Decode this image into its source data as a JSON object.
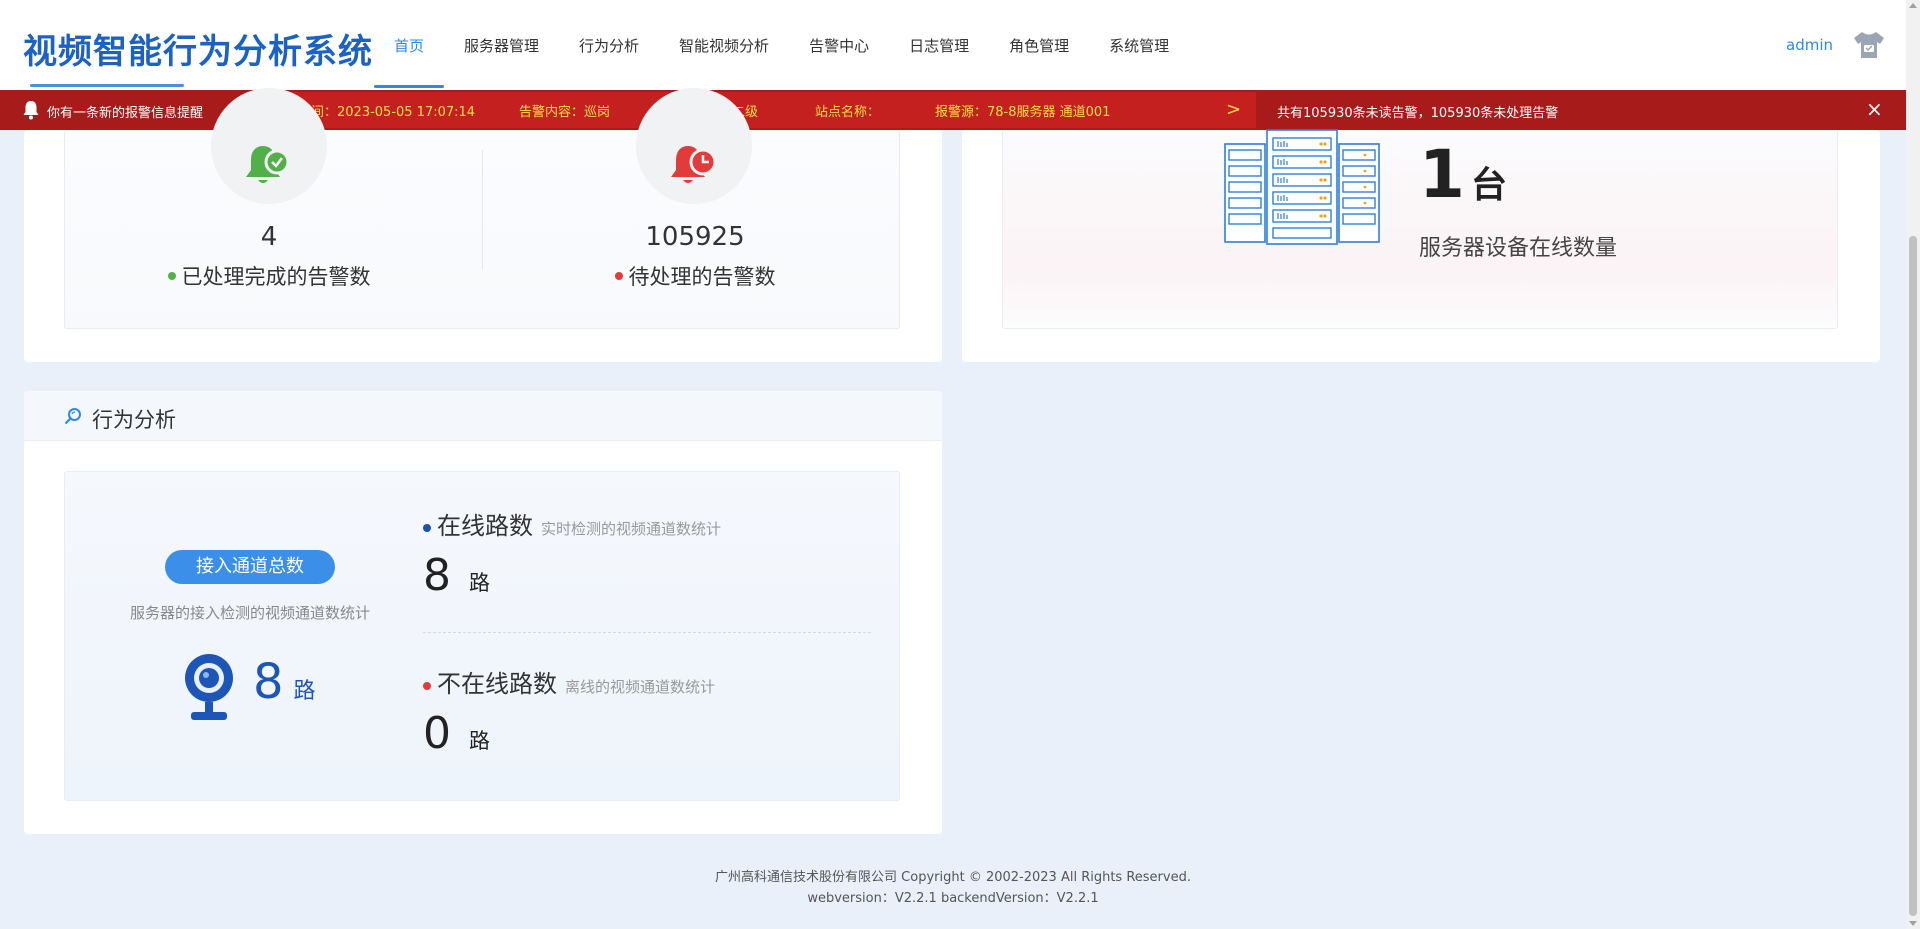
{
  "header": {
    "app_title": "视频智能行为分析系统",
    "nav": [
      {
        "label": "首页",
        "active": true
      },
      {
        "label": "服务器管理",
        "active": false
      },
      {
        "label": "行为分析",
        "active": false
      },
      {
        "label": "智能视频分析",
        "active": false
      },
      {
        "label": "告警中心",
        "active": false
      },
      {
        "label": "日志管理",
        "active": false
      },
      {
        "label": "角色管理",
        "active": false
      },
      {
        "label": "系统管理",
        "active": false
      }
    ],
    "user_name": "admin",
    "icons": {
      "skin": "shirt-icon"
    }
  },
  "alert_bar": {
    "message": "你有一条新的报警信息提醒",
    "alarm_time": "告警时间：2023-05-05 17:07:14",
    "alarm_content": "告警内容：巡岗",
    "alarm_level": "告警级别：二级",
    "site_name": "站点名称：",
    "alarm_source": "报警源：78-8服务器 通道001",
    "next_glyph": ">",
    "summary": "共有105930条未读告警，105930条未处理告警",
    "close_glyph": "×",
    "colors": {
      "bar": "#a81b1b",
      "ticker": "#c42020",
      "highlight": "#ffe046"
    }
  },
  "alarm_stats": {
    "processed": {
      "value": "4",
      "label": "已处理完成的告警数",
      "icon": "bell-check-icon"
    },
    "pending": {
      "value": "105925",
      "label": "待处理的告警数",
      "icon": "bell-clock-icon"
    }
  },
  "server_stats": {
    "count": "1",
    "unit": "台",
    "label": "服务器设备在线数量",
    "icon": "server-rack-icon"
  },
  "behavior": {
    "title": "行为分析",
    "total_badge": "接入通道总数",
    "total_desc": "服务器的接入检测的视频通道数统计",
    "total_value": "8",
    "total_unit": "路",
    "online": {
      "title": "在线路数",
      "sub": "实时检测的视频通道数统计",
      "value": "8",
      "unit": "路"
    },
    "offline": {
      "title": "不在线路数",
      "sub": "离线的视频通道数统计",
      "value": "0",
      "unit": "路"
    }
  },
  "footer": {
    "copyright": "广州高科通信技术股份有限公司 Copyright © 2002-2023 All Rights Reserved.",
    "version": "webversion：V2.2.1 backendVersion：V2.2.1"
  },
  "colors": {
    "brand": "#1b62c4",
    "accent": "#2f88e8",
    "success": "#52b04a",
    "danger": "#e23b3b"
  }
}
